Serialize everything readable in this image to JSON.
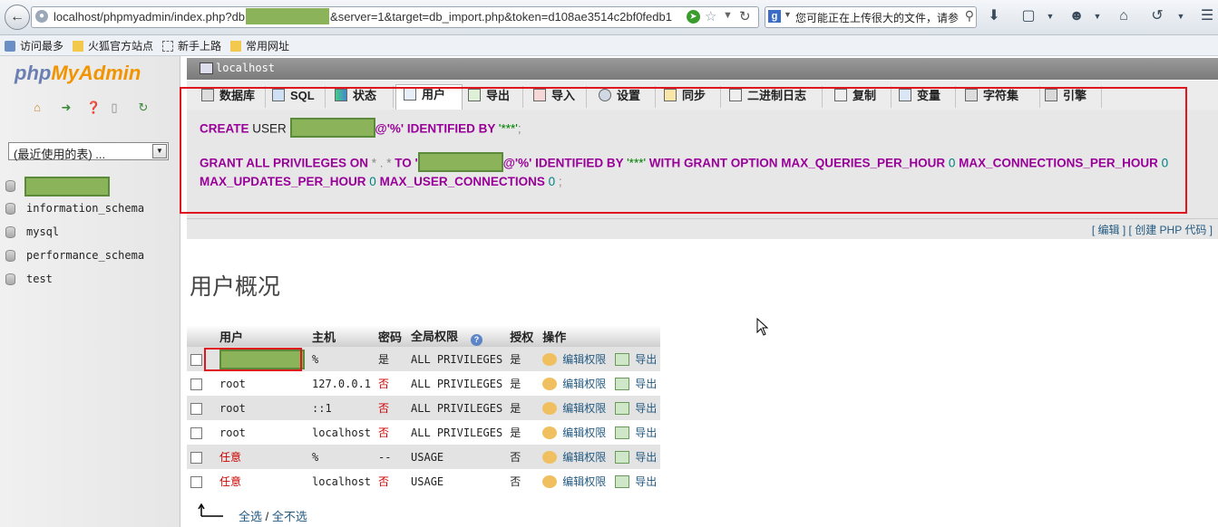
{
  "browser": {
    "url_prefix": "localhost/phpmyadmin/index.php?db",
    "url_suffix": "&server=1&target=db_import.php&token=d108ae3514c2bf0fedb1",
    "search_text": "您可能正在上传很大的文件，请参",
    "bookmarks": [
      "访问最多",
      "火狐官方站点",
      "新手上路",
      "常用网址"
    ]
  },
  "sidebar": {
    "logo_php": "php",
    "logo_my": "My",
    "logo_admin": "Admin",
    "recent_tables": "(最近使用的表) ...",
    "databases": [
      "information_schema",
      "mysql",
      "performance_schema",
      "test"
    ]
  },
  "server": {
    "label": "localhost"
  },
  "tabs": [
    "数据库",
    "SQL",
    "状态",
    "用户",
    "导出",
    "导入",
    "设置",
    "同步",
    "二进制日志",
    "复制",
    "变量",
    "字符集",
    "引擎"
  ],
  "sql": {
    "l1_kw": "CREATE",
    "l1_plain": " USER ",
    "l1_host": "@'%'",
    "l1_rest": " IDENTIFIED BY ",
    "l1_pwd": "'***'",
    "l1_end": ";",
    "l2_kw": "GRANT ALL PRIVILEGES ON ",
    "l2_star": "* . *",
    "l2_to": " TO '",
    "l2_host": "@'%'",
    "l2_ident": " IDENTIFIED BY ",
    "l2_pwd": "'***'",
    "l2_grant": " WITH GRANT OPTION MAX_QUERIES_PER_HOUR ",
    "l2_q": "0",
    "l2_conn": " MAX_CONNECTIONS_PER_HOUR ",
    "l2_c": "0",
    "l3_upd": "MAX_UPDATES_PER_HOUR ",
    "l3_u": "0",
    "l3_user": " MAX_USER_CONNECTIONS ",
    "l3_uc": "0",
    "l3_end": " ;"
  },
  "edit_links": {
    "open1": "[ ",
    "edit": "编辑",
    "mid": " ] [ ",
    "php": "创建 PHP 代码",
    "close": " ]"
  },
  "overview_title": "用户概况",
  "table": {
    "headers": [
      "用户",
      "主机",
      "密码",
      "全局权限",
      "授权",
      "操作"
    ],
    "edit_label": "编辑权限",
    "export_label": "导出",
    "rows": [
      {
        "user": "",
        "host": "%",
        "password": "是",
        "privileges": "ALL PRIVILEGES",
        "grant": "是",
        "masked": true
      },
      {
        "user": "root",
        "host": "127.0.0.1",
        "password": "否",
        "privileges": "ALL PRIVILEGES",
        "grant": "是"
      },
      {
        "user": "root",
        "host": "::1",
        "password": "否",
        "privileges": "ALL PRIVILEGES",
        "grant": "是"
      },
      {
        "user": "root",
        "host": "localhost",
        "password": "否",
        "privileges": "ALL PRIVILEGES",
        "grant": "是"
      },
      {
        "user": "任意",
        "host": "%",
        "password": "--",
        "privileges": "USAGE",
        "grant": "否"
      },
      {
        "user": "任意",
        "host": "localhost",
        "password": "否",
        "privileges": "USAGE",
        "grant": "否"
      }
    ],
    "select_all": "全选",
    "sep": " / ",
    "select_none": "全不选"
  },
  "colors": {
    "highlight_frame": "#e0161e",
    "redaction": "#8bb35a",
    "link": "#235a81",
    "keyword": "#990099"
  }
}
